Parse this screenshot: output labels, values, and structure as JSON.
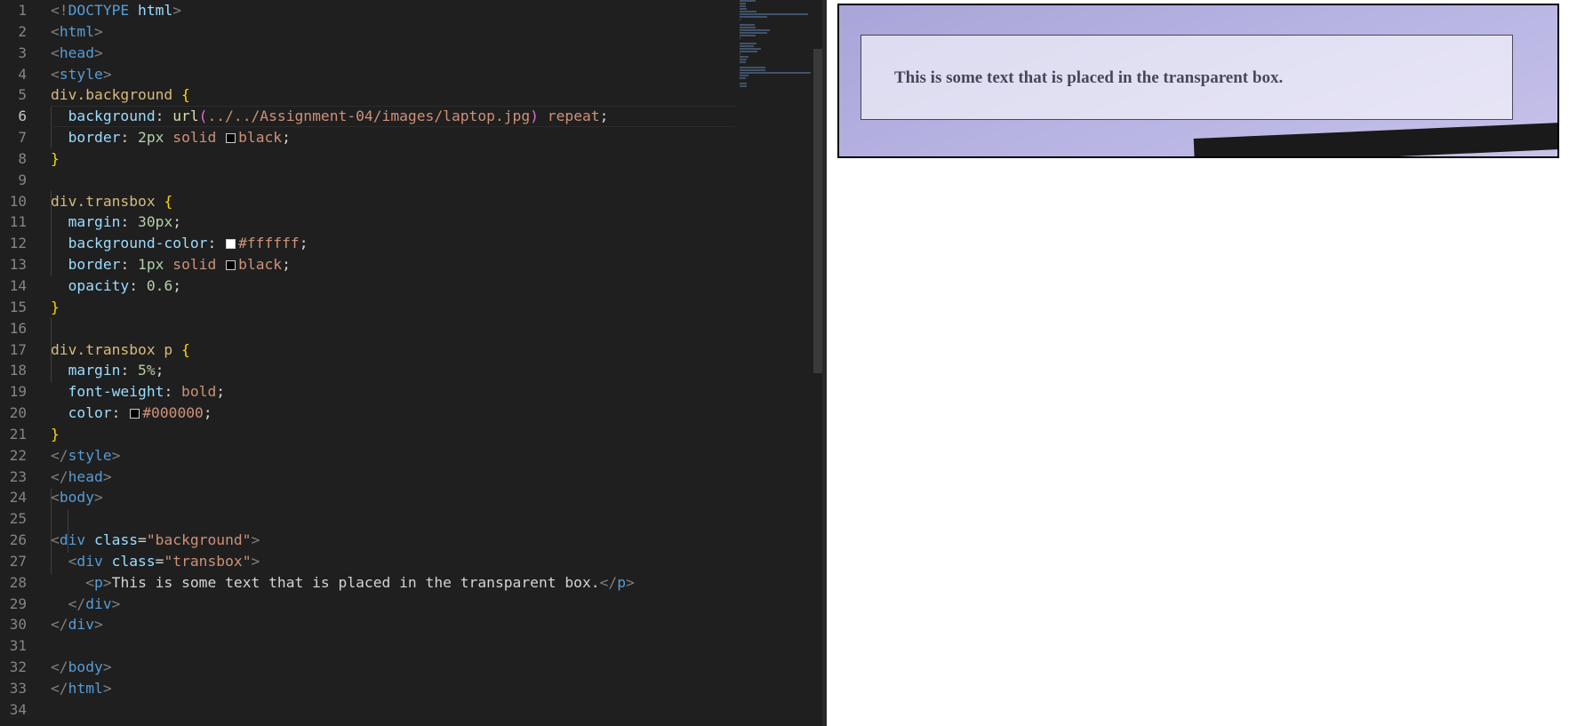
{
  "editor": {
    "active_line": 6,
    "lines": [
      {
        "n": "1",
        "parts": [
          [
            "t-br",
            "<!"
          ],
          [
            "t-tag",
            "DOCTYPE "
          ],
          [
            "t-attr",
            "html"
          ],
          [
            "t-br",
            ">"
          ]
        ]
      },
      {
        "n": "2",
        "parts": [
          [
            "t-br",
            "<"
          ],
          [
            "t-tag",
            "html"
          ],
          [
            "t-br",
            ">"
          ]
        ]
      },
      {
        "n": "3",
        "parts": [
          [
            "t-br",
            "<"
          ],
          [
            "t-tag",
            "head"
          ],
          [
            "t-br",
            ">"
          ]
        ]
      },
      {
        "n": "4",
        "parts": [
          [
            "t-br",
            "<"
          ],
          [
            "t-tag",
            "style"
          ],
          [
            "t-br",
            ">"
          ]
        ]
      },
      {
        "n": "5",
        "parts": [
          [
            "t-sel",
            "div.background "
          ],
          [
            "t-brace",
            "{"
          ]
        ]
      },
      {
        "n": "6",
        "parts": [
          [
            "t-text",
            "  "
          ],
          [
            "t-prop",
            "background"
          ],
          [
            "t-punc",
            ": "
          ],
          [
            "t-fn",
            "url"
          ],
          [
            "t-paren",
            "("
          ],
          [
            "t-str",
            "../../Assignment-04/images/laptop.jpg"
          ],
          [
            "t-paren",
            ")"
          ],
          [
            "t-val",
            " repeat"
          ],
          [
            "t-punc",
            ";"
          ]
        ]
      },
      {
        "n": "7",
        "parts": [
          [
            "t-text",
            "  "
          ],
          [
            "t-prop",
            "border"
          ],
          [
            "t-punc",
            ": "
          ],
          [
            "t-num",
            "2px"
          ],
          [
            "t-val",
            " solid "
          ],
          [
            "swatch-black",
            ""
          ],
          [
            "t-val",
            "black"
          ],
          [
            "t-punc",
            ";"
          ]
        ]
      },
      {
        "n": "8",
        "parts": [
          [
            "t-brace",
            "}"
          ]
        ]
      },
      {
        "n": "9",
        "parts": []
      },
      {
        "n": "10",
        "parts": [
          [
            "t-sel",
            "div.transbox "
          ],
          [
            "t-brace",
            "{"
          ]
        ]
      },
      {
        "n": "11",
        "parts": [
          [
            "t-text",
            "  "
          ],
          [
            "t-prop",
            "margin"
          ],
          [
            "t-punc",
            ": "
          ],
          [
            "t-num",
            "30px"
          ],
          [
            "t-punc",
            ";"
          ]
        ]
      },
      {
        "n": "12",
        "parts": [
          [
            "t-text",
            "  "
          ],
          [
            "t-prop",
            "background-color"
          ],
          [
            "t-punc",
            ": "
          ],
          [
            "swatch-white",
            ""
          ],
          [
            "t-val",
            "#ffffff"
          ],
          [
            "t-punc",
            ";"
          ]
        ]
      },
      {
        "n": "13",
        "parts": [
          [
            "t-text",
            "  "
          ],
          [
            "t-prop",
            "border"
          ],
          [
            "t-punc",
            ": "
          ],
          [
            "t-num",
            "1px"
          ],
          [
            "t-val",
            " solid "
          ],
          [
            "swatch-black",
            ""
          ],
          [
            "t-val",
            "black"
          ],
          [
            "t-punc",
            ";"
          ]
        ]
      },
      {
        "n": "14",
        "parts": [
          [
            "t-text",
            "  "
          ],
          [
            "t-prop",
            "opacity"
          ],
          [
            "t-punc",
            ": "
          ],
          [
            "t-num",
            "0.6"
          ],
          [
            "t-punc",
            ";"
          ]
        ]
      },
      {
        "n": "15",
        "parts": [
          [
            "t-brace",
            "}"
          ]
        ]
      },
      {
        "n": "16",
        "parts": []
      },
      {
        "n": "17",
        "parts": [
          [
            "t-sel",
            "div.transbox p "
          ],
          [
            "t-brace",
            "{"
          ]
        ]
      },
      {
        "n": "18",
        "parts": [
          [
            "t-text",
            "  "
          ],
          [
            "t-prop",
            "margin"
          ],
          [
            "t-punc",
            ": "
          ],
          [
            "t-num",
            "5%"
          ],
          [
            "t-punc",
            ";"
          ]
        ]
      },
      {
        "n": "19",
        "parts": [
          [
            "t-text",
            "  "
          ],
          [
            "t-prop",
            "font-weight"
          ],
          [
            "t-punc",
            ": "
          ],
          [
            "t-val",
            "bold"
          ],
          [
            "t-punc",
            ";"
          ]
        ]
      },
      {
        "n": "20",
        "parts": [
          [
            "t-text",
            "  "
          ],
          [
            "t-prop",
            "color"
          ],
          [
            "t-punc",
            ": "
          ],
          [
            "swatch-black",
            ""
          ],
          [
            "t-val",
            "#000000"
          ],
          [
            "t-punc",
            ";"
          ]
        ]
      },
      {
        "n": "21",
        "parts": [
          [
            "t-brace",
            "}"
          ]
        ]
      },
      {
        "n": "22",
        "parts": [
          [
            "t-br",
            "</"
          ],
          [
            "t-tag",
            "style"
          ],
          [
            "t-br",
            ">"
          ]
        ]
      },
      {
        "n": "23",
        "parts": [
          [
            "t-br",
            "</"
          ],
          [
            "t-tag",
            "head"
          ],
          [
            "t-br",
            ">"
          ]
        ]
      },
      {
        "n": "24",
        "parts": [
          [
            "t-br",
            "<"
          ],
          [
            "t-tag",
            "body"
          ],
          [
            "t-br",
            ">"
          ]
        ]
      },
      {
        "n": "25",
        "parts": []
      },
      {
        "n": "26",
        "parts": [
          [
            "t-br",
            "<"
          ],
          [
            "t-tag",
            "div "
          ],
          [
            "t-attr",
            "class"
          ],
          [
            "t-punc",
            "="
          ],
          [
            "t-str",
            "\"background\""
          ],
          [
            "t-br",
            ">"
          ]
        ]
      },
      {
        "n": "27",
        "parts": [
          [
            "t-text",
            "  "
          ],
          [
            "t-br",
            "<"
          ],
          [
            "t-tag",
            "div "
          ],
          [
            "t-attr",
            "class"
          ],
          [
            "t-punc",
            "="
          ],
          [
            "t-str",
            "\"transbox\""
          ],
          [
            "t-br",
            ">"
          ]
        ]
      },
      {
        "n": "28",
        "parts": [
          [
            "t-text",
            "    "
          ],
          [
            "t-br",
            "<"
          ],
          [
            "t-tag",
            "p"
          ],
          [
            "t-br",
            ">"
          ],
          [
            "t-text",
            "This is some text that is placed in the transparent box."
          ],
          [
            "t-br",
            "</"
          ],
          [
            "t-tag",
            "p"
          ],
          [
            "t-br",
            ">"
          ]
        ]
      },
      {
        "n": "29",
        "parts": [
          [
            "t-text",
            "  "
          ],
          [
            "t-br",
            "</"
          ],
          [
            "t-tag",
            "div"
          ],
          [
            "t-br",
            ">"
          ]
        ]
      },
      {
        "n": "30",
        "parts": [
          [
            "t-br",
            "</"
          ],
          [
            "t-tag",
            "div"
          ],
          [
            "t-br",
            ">"
          ]
        ]
      },
      {
        "n": "31",
        "parts": []
      },
      {
        "n": "32",
        "parts": [
          [
            "t-br",
            "</"
          ],
          [
            "t-tag",
            "body"
          ],
          [
            "t-br",
            ">"
          ]
        ]
      },
      {
        "n": "33",
        "parts": [
          [
            "t-br",
            "</"
          ],
          [
            "t-tag",
            "html"
          ],
          [
            "t-br",
            ">"
          ]
        ]
      },
      {
        "n": "34",
        "parts": []
      }
    ]
  },
  "preview": {
    "transbox_text": "This is some text that is placed in the transparent box.",
    "background_colors": [
      "#a9a5d8",
      "#c6c2ea"
    ]
  }
}
